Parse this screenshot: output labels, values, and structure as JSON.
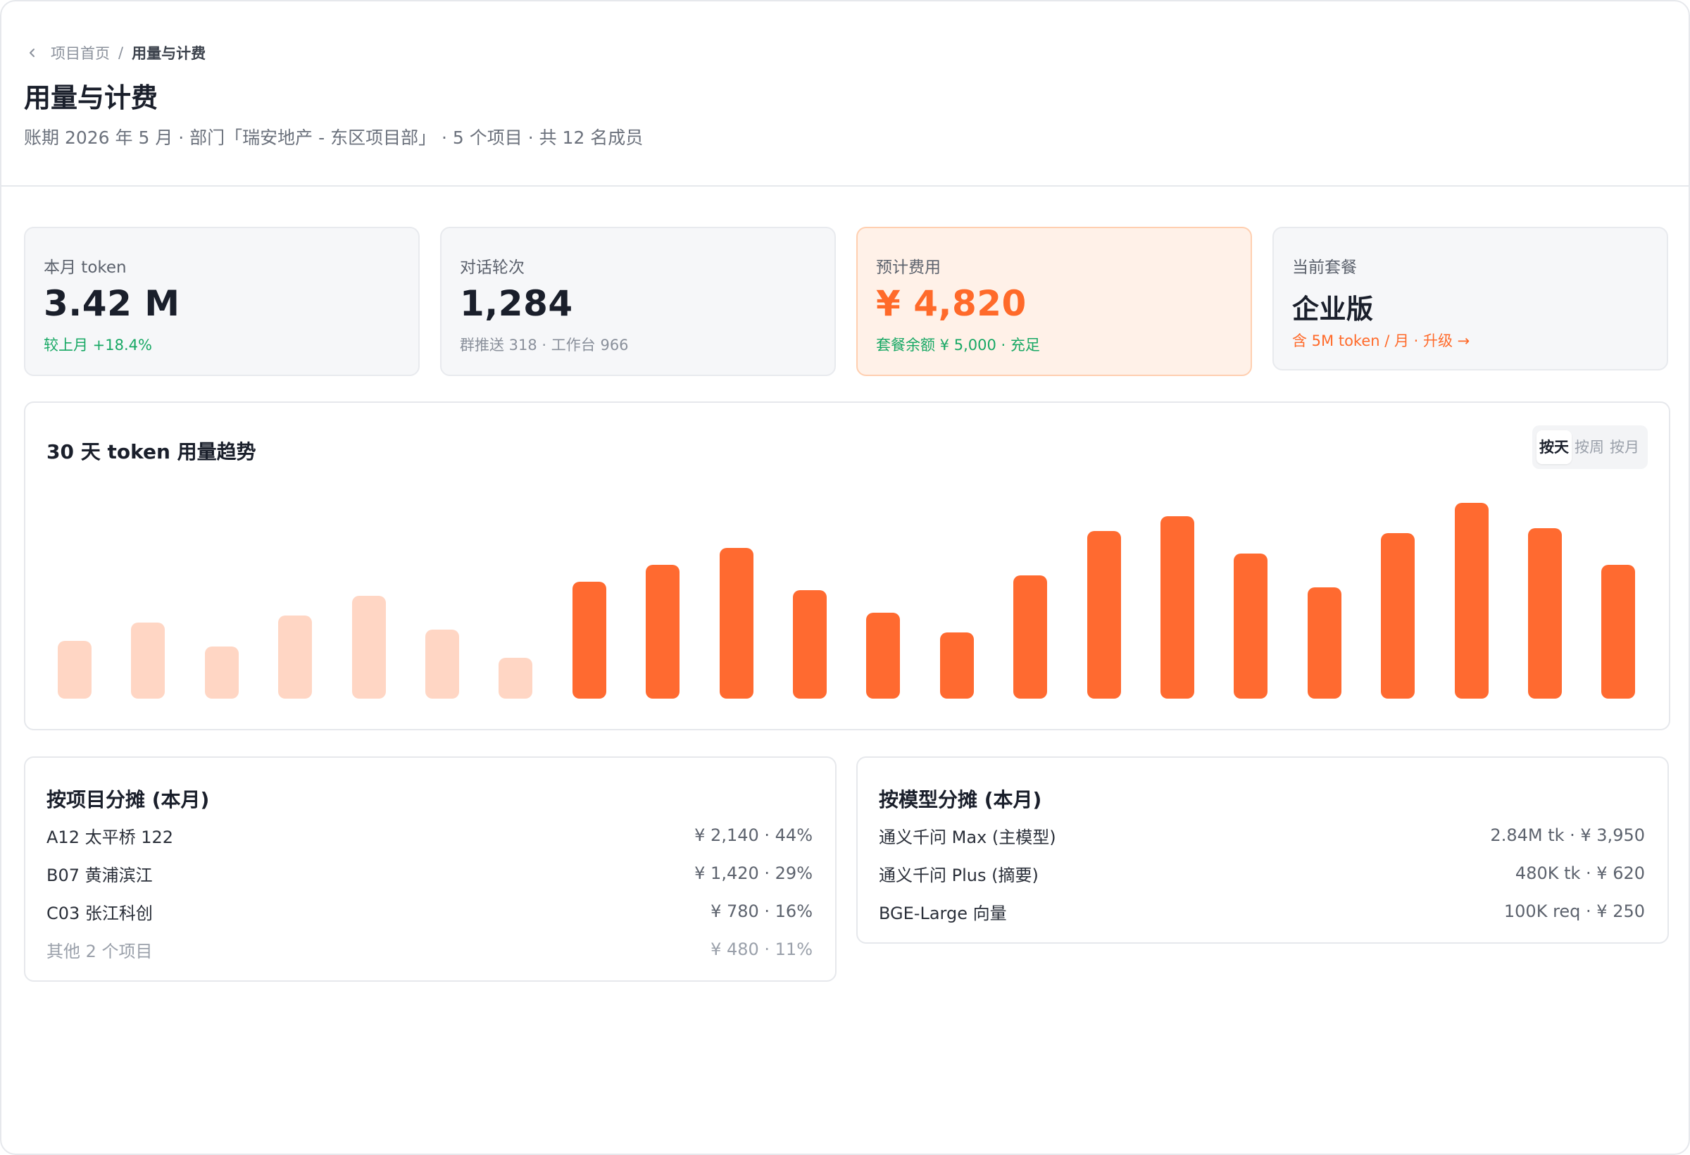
{
  "header": {
    "breadcrumb": {
      "parent": "项目首页",
      "separator": "/",
      "current": "用量与计费"
    },
    "title": "用量与计费",
    "subtitle": "账期 2026 年 5 月 · 部门「瑞安地产 - 东区项目部」 · 5 个项目 · 共 12 名成员"
  },
  "kpis": [
    {
      "label": "本月 token",
      "value": "3.42 M",
      "note": "较上月 +18.4%"
    },
    {
      "label": "对话轮次",
      "value": "1,284",
      "note": "群推送 318 · 工作台 966"
    },
    {
      "label": "预计费用",
      "value": "¥ 4,820",
      "note": "套餐余额 ¥ 5,000 · 充足"
    },
    {
      "label": "当前套餐",
      "value": "企业版",
      "note": "含 5M token / 月 · 升级 →"
    }
  ],
  "chart": {
    "title": "30 天 token 用量趋势",
    "toggle": [
      "按天",
      "按周",
      "按月"
    ],
    "active_toggle": "按天"
  },
  "chart_data": {
    "type": "bar",
    "values": [
      34,
      45,
      31,
      49,
      61,
      41,
      24,
      69,
      79,
      89,
      64,
      51,
      39,
      73,
      99,
      108,
      86,
      66,
      98,
      116,
      101,
      79
    ],
    "series_colors": {
      "past": "#ffd6c4",
      "current": "#ff6a30"
    },
    "past_count": 7
  },
  "project_breakdown": {
    "title": "按项目分摊 (本月)",
    "rows": [
      {
        "name": "A12 太平桥 122",
        "value": "¥ 2,140 · 44%"
      },
      {
        "name": "B07 黄浦滨江",
        "value": "¥ 1,420 · 29%"
      },
      {
        "name": "C03 张江科创",
        "value": "¥ 780 · 16%"
      },
      {
        "name": "其他 2 个项目",
        "value": "¥ 480 · 11%"
      }
    ]
  },
  "model_breakdown": {
    "title": "按模型分摊 (本月)",
    "rows": [
      {
        "name": "通义千问 Max (主模型)",
        "value": "2.84M tk · ¥ 3,950"
      },
      {
        "name": "通义千问 Plus (摘要)",
        "value": "480K tk · ¥ 620"
      },
      {
        "name": "BGE-Large 向量",
        "value": "100K req · ¥ 250"
      }
    ]
  }
}
